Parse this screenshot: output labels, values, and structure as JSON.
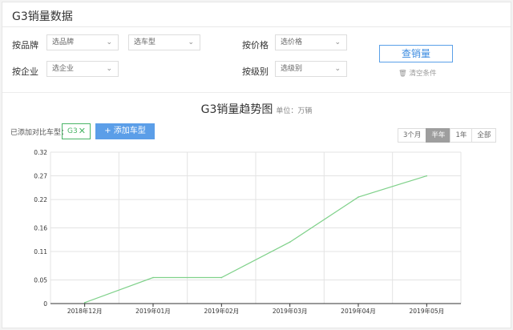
{
  "header": {
    "title": "G3销量数据"
  },
  "filters": {
    "brand": {
      "label": "按品牌",
      "value": "选品牌"
    },
    "model": {
      "value": "选车型"
    },
    "company": {
      "label": "按企业",
      "value": "选企业"
    },
    "price": {
      "label": "按价格",
      "value": "选价格"
    },
    "level": {
      "label": "按级别",
      "value": "选级别"
    },
    "query_button": "查销量",
    "clear_label": "清空条件"
  },
  "chart_header": {
    "title": "G3销量趋势图",
    "unit": "单位：万辆",
    "added_label": "已添加对比车型：",
    "car_tag": "G3",
    "add_button": "+ 添加车型",
    "ranges": [
      "3个月",
      "半年",
      "1年",
      "全部"
    ],
    "active_range": "半年"
  },
  "icons": {
    "dropdown": "chevron-down-icon",
    "close": "close-icon",
    "clear": "trash-icon"
  },
  "colors": {
    "line": "#7fd18a",
    "accent": "#3b8be0",
    "tag": "#4ab567",
    "active_range": "#9e9e9e"
  },
  "chart_data": {
    "type": "line",
    "categories": [
      "2018年12月",
      "2019年01月",
      "2019年02月",
      "2019年03月",
      "2019年04月",
      "2019年05月"
    ],
    "series": [
      {
        "values": [
          0.002,
          0.055,
          0.055,
          0.13,
          0.225,
          0.27
        ]
      }
    ],
    "yticks": [
      "0",
      "0.05",
      "0.11",
      "0.16",
      "0.22",
      "0.27",
      "0.32"
    ],
    "ylim": [
      0,
      0.32
    ],
    "grid": true
  }
}
